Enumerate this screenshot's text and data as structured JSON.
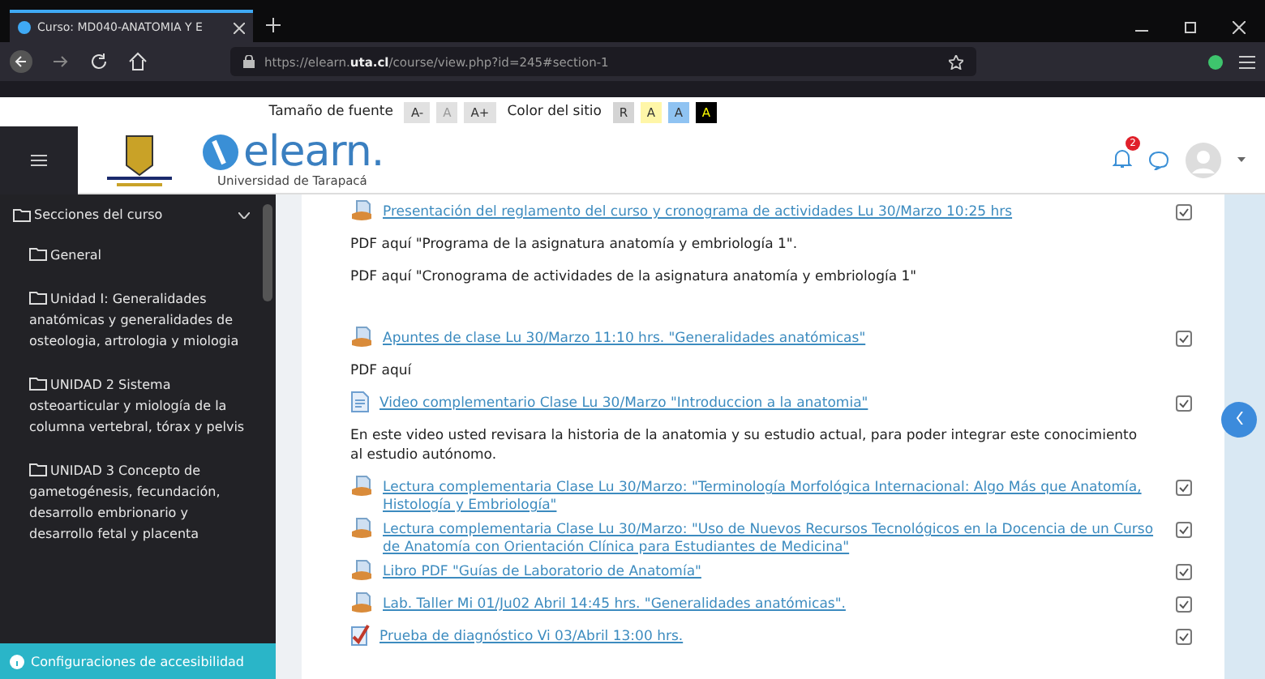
{
  "browser": {
    "tab_title": "Curso: MD040-ANATOMIA Y E",
    "url": "https://elearn.**uta.cl**/course/view.php?id=245#section-1"
  },
  "accessibility_bar": {
    "font_size_label": "Tamaño de fuente",
    "font_buttons": [
      "A-",
      "A",
      "A+"
    ],
    "color_label": "Color del sitio",
    "color_buttons": [
      {
        "label": "R",
        "color": "#d4d4d4"
      },
      {
        "label": "A",
        "color": "#fff6a8"
      },
      {
        "label": "A",
        "color": "#8fc3f2"
      },
      {
        "label": "A",
        "color": "#000000"
      }
    ]
  },
  "header": {
    "logo_text": "elearn.",
    "logo_subtitle": "Universidad de Tarapacá",
    "notification_count": "2"
  },
  "sidebar": {
    "title": "Secciones del curso",
    "expanded": true,
    "items": [
      "General",
      "Unidad I: Generalidades anatómicas y generalidades de osteologia, artrologia y miologia",
      "UNIDAD 2 Sistema osteoarticular y miología de la columna vertebral, tórax y pelvis",
      "UNIDAD 3 Concepto de gametogénesis, fecundación, desarrollo embrionario y desarrollo fetal y placenta"
    ],
    "footer": "Configuraciones de accesibilidad"
  },
  "activities": [
    {
      "kind": "document",
      "text": "Presentación del reglamento del curso y cronograma de actividades Lu 30/Marzo 10:25 hrs",
      "checked": true
    },
    {
      "kind": "text",
      "text": "PDF aquí   \"Programa de la asignatura  anatomía y embriología 1\"."
    },
    {
      "kind": "text",
      "text": "PDF aquí   \"Cronograma de actividades de la asignatura anatomía y embriología 1\""
    },
    {
      "kind": "gap"
    },
    {
      "kind": "document",
      "text": "Apuntes de clase Lu 30/Marzo 11:10 hrs. \"Generalidades anatómicas\"",
      "checked": true
    },
    {
      "kind": "text",
      "text": "PDF aquí"
    },
    {
      "kind": "page",
      "text": "Video complementario Clase Lu 30/Marzo \"Introduccion a la anatomia\"",
      "checked": true
    },
    {
      "kind": "text",
      "text": "En este video usted revisara la historia de la anatomia y su estudio actual, para poder integrar este conocimiento al estudio autónomo."
    },
    {
      "kind": "document",
      "text": " Lectura complementaria Clase Lu 30/Marzo: \"Terminología Morfológica Internacional: Algo Más que Anatomía, Histología y Embriología\"",
      "checked": true
    },
    {
      "kind": "document",
      "text": " Lectura complementaria Clase Lu 30/Marzo: \"Uso de Nuevos Recursos Tecnológicos en la Docencia de un Curso de Anatomía con Orientación Clínica para Estudiantes de Medicina\"",
      "checked": true
    },
    {
      "kind": "document",
      "text": "Libro PDF \"Guías de Laboratorio de Anatomía\"",
      "checked": true
    },
    {
      "kind": "document",
      "text": " Lab. Taller Mi 01/Ju02 Abril 14:45 hrs. \"Generalidades anatómicas\".",
      "checked": true
    },
    {
      "kind": "quiz",
      "text": "Prueba de diagnóstico Vi 03/Abril 13:00 hrs.",
      "checked": true
    }
  ]
}
